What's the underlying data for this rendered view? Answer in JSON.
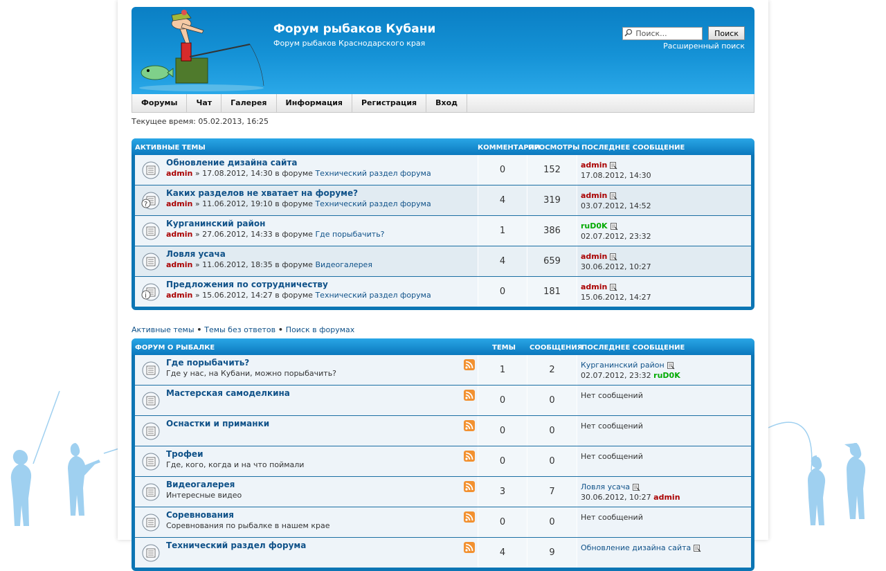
{
  "header": {
    "title": "Форум рыбаков Кубани",
    "description": "Форум рыбаков Краснодарского края",
    "search_placeholder": "Поиск...",
    "search_button": "Поиск",
    "advanced_search": "Расширенный поиск"
  },
  "nav": [
    "Форумы",
    "Чат",
    "Галерея",
    "Информация",
    "Регистрация",
    "Вход"
  ],
  "current_time": "Текущее время: 05.02.2013, 16:25",
  "active": {
    "headers": {
      "title": "Активные темы",
      "c1": "Комментарии",
      "c2": "Просмотры",
      "last": "Последнее сообщение"
    },
    "rows": [
      {
        "title": "Обновление дизайна сайта",
        "author": "admin",
        "meta": " » 17.08.2012, 14:30 в форуме ",
        "forum": "Технический раздел форума",
        "c1": "0",
        "c2": "152",
        "last_author": "admin",
        "last_date": "17.08.2012, 14:30",
        "icon": "topic"
      },
      {
        "title": "Каких разделов не хватает на форуме?",
        "author": "admin",
        "meta": " » 11.06.2012, 19:10 в форуме ",
        "forum": "Технический раздел форума",
        "c1": "4",
        "c2": "319",
        "last_author": "admin",
        "last_date": "03.07.2012, 14:52",
        "icon": "poll"
      },
      {
        "title": "Курганинский район",
        "author": "admin",
        "meta": " » 27.06.2012, 14:33 в форуме ",
        "forum": "Где порыбачить?",
        "c1": "1",
        "c2": "386",
        "last_author": "ruD0K",
        "last_date": "02.07.2012, 23:32",
        "icon": "topic"
      },
      {
        "title": "Ловля усача",
        "author": "admin",
        "meta": " » 11.06.2012, 18:35 в форуме ",
        "forum": "Видеогалерея",
        "c1": "4",
        "c2": "659",
        "last_author": "admin",
        "last_date": "30.06.2012, 10:27",
        "icon": "topic"
      },
      {
        "title": "Предложения по сотрудничеству",
        "author": "admin",
        "meta": " » 15.06.2012, 14:27 в форуме ",
        "forum": "Технический раздел форума",
        "c1": "0",
        "c2": "181",
        "last_author": "admin",
        "last_date": "15.06.2012, 14:27",
        "icon": "info"
      }
    ]
  },
  "links": {
    "active": "Активные темы",
    "unanswered": "Темы без ответов",
    "search": "Поиск в форумах",
    "sep": " • "
  },
  "forum": {
    "headers": {
      "title": "Форум о рыбалке",
      "c1": "Темы",
      "c2": "Сообщения",
      "last": "Последнее сообщение"
    },
    "rows": [
      {
        "title": "Где порыбачить?",
        "desc": "Где у нас, на Кубани, можно порыбачить?",
        "c1": "1",
        "c2": "2",
        "last_topic": "Курганинский район",
        "last_date": "02.07.2012, 23:32 ",
        "last_author": "ruD0K"
      },
      {
        "title": "Мастерская самоделкина",
        "desc": "",
        "c1": "0",
        "c2": "0",
        "no_posts": "Нет сообщений"
      },
      {
        "title": "Оснастки и приманки",
        "desc": "",
        "c1": "0",
        "c2": "0",
        "no_posts": "Нет сообщений"
      },
      {
        "title": "Трофеи",
        "desc": "Где, кого, когда и на что поймали",
        "c1": "0",
        "c2": "0",
        "no_posts": "Нет сообщений"
      },
      {
        "title": "Видеогалерея",
        "desc": "Интересные видео",
        "c1": "3",
        "c2": "7",
        "last_topic": "Ловля усача",
        "last_date": "30.06.2012, 10:27 ",
        "last_author": "admin"
      },
      {
        "title": "Соревнования",
        "desc": "Соревнования по рыбалке в нашем крае",
        "c1": "0",
        "c2": "0",
        "no_posts": "Нет сообщений"
      },
      {
        "title": "Технический раздел форума",
        "desc": "",
        "c1": "4",
        "c2": "9",
        "last_topic": "Обновление дизайна сайта",
        "last_date": "",
        "last_author": ""
      }
    ]
  },
  "colors": {
    "accent": "#0c75b4",
    "link": "#105289",
    "author": "#aa0000",
    "green_user": "#00aa00"
  }
}
